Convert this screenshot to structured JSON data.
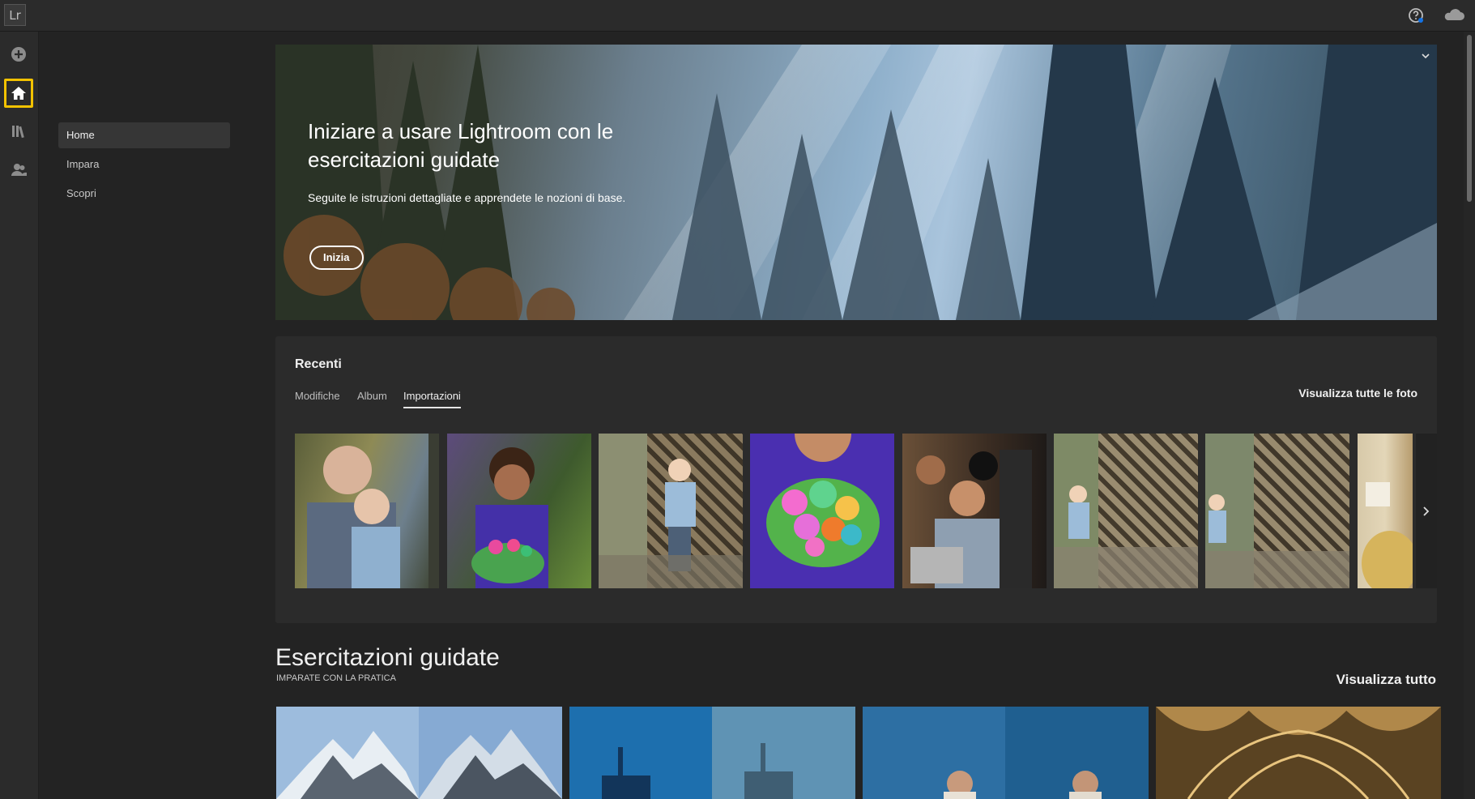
{
  "app": {
    "logo_text": "Lr"
  },
  "topbar": {
    "help_icon": "help-icon",
    "cloud_icon": "cloud-icon"
  },
  "rail": {
    "items": [
      "add-icon",
      "home-icon",
      "library-icon",
      "people-icon"
    ],
    "active": "home-icon"
  },
  "subnav": {
    "items": [
      {
        "label": "Home"
      },
      {
        "label": "Impara"
      },
      {
        "label": "Scopri"
      }
    ],
    "active": "Home"
  },
  "hero": {
    "title": "Iniziare a usare Lightroom con le esercitazioni guidate",
    "subtitle": "Seguite le istruzioni dettagliate e apprendete le nozioni di base.",
    "button": "Inizia"
  },
  "recent": {
    "title": "Recenti",
    "tabs": [
      {
        "label": "Modifiche"
      },
      {
        "label": "Album"
      },
      {
        "label": "Importazioni"
      }
    ],
    "active_tab": "Importazioni",
    "see_all": "Visualizza tutte le foto",
    "thumbnails": 8
  },
  "guided": {
    "title": "Esercitazioni guidate",
    "subtitle": "IMPARATE CON LA PRATICA",
    "see_all": "Visualizza tutto"
  },
  "colors": {
    "accent": "#f2c200",
    "background": "#232323",
    "panel": "#2b2b2b"
  }
}
